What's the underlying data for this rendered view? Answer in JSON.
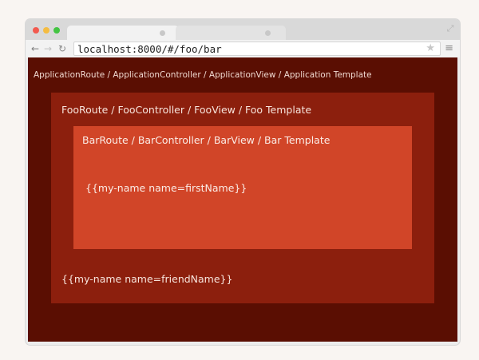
{
  "browser": {
    "url": "localhost:8000/#/foo/bar",
    "icons": {
      "back": "arrow-left-icon",
      "forward": "arrow-right-icon",
      "reload": "reload-icon",
      "star": "star-icon",
      "menu": "hamburger-menu-icon",
      "expand": "expand-icon"
    }
  },
  "page": {
    "application_label": "ApplicationRoute / ApplicationController / ApplicationView / Application Template",
    "foo": {
      "label": "FooRoute / FooController / FooView / Foo Template",
      "content": "{{my-name name=friendName}}"
    },
    "bar": {
      "label": "BarRoute / BarController / BarView / Bar Template",
      "content": "{{my-name name=firstName}}"
    }
  },
  "colors": {
    "application_bg": "#5a0e02",
    "foo_bg": "#8c1f0d",
    "bar_bg": "#d14528"
  }
}
